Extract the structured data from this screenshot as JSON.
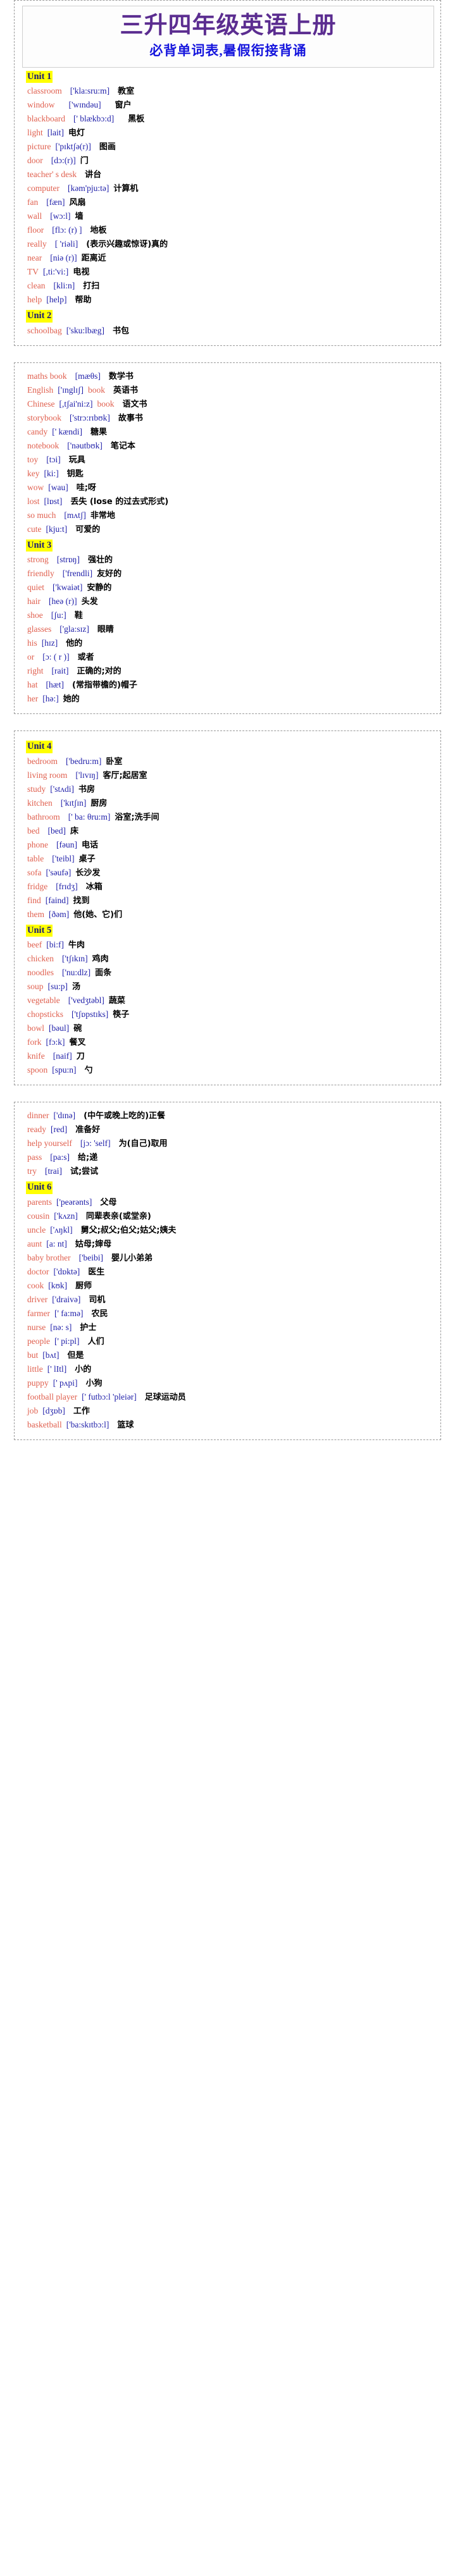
{
  "document": {
    "title_main": "三升四年级英语上册",
    "title_sub": "必背单词表,暑假衔接背诵",
    "colors": {
      "title_main": "#5b2d90",
      "title_sub": "#1515dd",
      "english_word": "#e0604f",
      "phonetic": "#1d1da8",
      "chinese": "#000000",
      "unit_highlight": "#ffff00",
      "unit_text": "#16167a",
      "page_border": "#9a9a9a"
    }
  },
  "blocks": [
    {
      "id": "block-1",
      "sections": [
        {
          "unit": "Unit 1",
          "words": [
            {
              "en": "classroom",
              "ph": "['kla:sru:m]",
              "cn": "教室",
              "gap1": "m",
              "gap2": "m"
            },
            {
              "en": "window",
              "ph": "['wɪndəu]",
              "cn": "窗户",
              "gap1": "l",
              "gap2": "l"
            },
            {
              "en": "blackboard",
              "ph": "[' blækbɔ:d]",
              "cn": "黑板",
              "gap1": "m",
              "gap2": "l"
            },
            {
              "en": "light",
              "ph": "[lait]",
              "cn": "电灯",
              "gap1": "s",
              "gap2": "s"
            },
            {
              "en": "picture",
              "ph": "['pɪktʃə(r)]",
              "cn": "图画",
              "gap1": "s",
              "gap2": "m"
            },
            {
              "en": "door",
              "ph": "[dɔ:(r)]",
              "cn": "门",
              "gap1": "m",
              "gap2": "s"
            },
            {
              "en": "teacher' s desk",
              "ph": "",
              "cn": "讲台",
              "gap1": "s",
              "gap2": "m"
            },
            {
              "en": "computer",
              "ph": "[kəm'pju:tə]",
              "cn": "计算机",
              "gap1": "m",
              "gap2": "s"
            },
            {
              "en": "fan",
              "ph": "[fæn]",
              "cn": "风扇",
              "gap1": "m",
              "gap2": "s"
            },
            {
              "en": "wall",
              "ph": "[wɔ:l]",
              "cn": "墙",
              "gap1": "m",
              "gap2": "s"
            },
            {
              "en": "floor",
              "ph": "[flɔ: (r) ]",
              "cn": "地板",
              "gap1": "m",
              "gap2": "m"
            },
            {
              "en": "really",
              "ph": "[ 'riəli]",
              "cn": "(表示兴趣或惊讶)真的",
              "gap1": "m",
              "gap2": "m"
            },
            {
              "en": "near",
              "ph": "[niə (r)]",
              "cn": "距离近",
              "gap1": "m",
              "gap2": "s"
            },
            {
              "en": "TV",
              "ph": "[,ti:'vi:]",
              "cn": "电视",
              "gap1": "s",
              "gap2": "s"
            },
            {
              "en": "clean",
              "ph": "[kli:n]",
              "cn": "打扫",
              "gap1": "m",
              "gap2": "m"
            },
            {
              "en": "help",
              "ph": "[help]",
              "cn": "帮助",
              "gap1": "s",
              "gap2": "m"
            }
          ]
        },
        {
          "unit": "Unit 2",
          "words": [
            {
              "en": "schoolbag",
              "ph": "['sku:lbæg]",
              "cn": "书包",
              "gap1": "s",
              "gap2": "m"
            }
          ]
        }
      ]
    },
    {
      "id": "block-2",
      "sections": [
        {
          "unit": "",
          "words": [
            {
              "en": "maths book",
              "ph": "[mæθs]",
              "cn": "数学书",
              "gap1": "m",
              "gap2": "m"
            },
            {
              "en": "English",
              "ph": "['ɪnglɪʃ]",
              "cn": "英语书",
              "suffix": "book",
              "gap1": "s",
              "gap2": "m"
            },
            {
              "en": "Chinese",
              "ph": "[,tʃai'ni:z]",
              "cn": "语文书",
              "suffix": "book",
              "gap1": "s",
              "gap2": "m"
            },
            {
              "en": "storybook",
              "ph": "['strɔ:rɪbʊk]",
              "cn": "故事书",
              "gap1": "m",
              "gap2": "m"
            },
            {
              "en": "candy",
              "ph": "[' kændi]",
              "cn": "糖果",
              "gap1": "s",
              "gap2": "m"
            },
            {
              "en": "notebook",
              "ph": "['nəutbʊk]",
              "cn": "笔记本",
              "gap1": "m",
              "gap2": "m"
            },
            {
              "en": "toy",
              "ph": "[tɔi]",
              "cn": "玩具",
              "gap1": "m",
              "gap2": "m"
            },
            {
              "en": "key",
              "ph": "[ki:]",
              "cn": "钥匙",
              "gap1": "s",
              "gap2": "m"
            },
            {
              "en": "wow",
              "ph": "[wau]",
              "cn": "哇;呀",
              "gap1": "s",
              "gap2": "m"
            },
            {
              "en": "lost",
              "ph": "[lɒst]",
              "cn": "丢失 (lose 的过去式形式)",
              "gap1": "s",
              "gap2": "m"
            },
            {
              "en": "so much",
              "ph": "[mʌtʃ]",
              "cn": "非常地",
              "gap1": "m",
              "gap2": "s"
            },
            {
              "en": "cute",
              "ph": "[kju:t]",
              "cn": "可爱的",
              "gap1": "s",
              "gap2": "m"
            }
          ]
        },
        {
          "unit": "Unit 3",
          "words": [
            {
              "en": "strong",
              "ph": "[strɒŋ]",
              "cn": "强壮的",
              "gap1": "m",
              "gap2": "m"
            },
            {
              "en": "friendly",
              "ph": "['frendli]",
              "cn": "友好的",
              "gap1": "m",
              "gap2": "s"
            },
            {
              "en": "quiet",
              "ph": "['kwaiət]",
              "cn": "安静的",
              "gap1": "m",
              "gap2": "s"
            },
            {
              "en": "hair",
              "ph": "[heə (r)]",
              "cn": "头发",
              "gap1": "m",
              "gap2": "s"
            },
            {
              "en": "shoe",
              "ph": "[ʃu:]",
              "cn": "鞋",
              "gap1": "m",
              "gap2": "m"
            },
            {
              "en": "glasses",
              "ph": "['gla:sɪz]",
              "cn": "眼睛",
              "gap1": "m",
              "gap2": "m"
            },
            {
              "en": "his",
              "ph": "[hɪz]",
              "cn": "他的",
              "gap1": "s",
              "gap2": "m"
            },
            {
              "en": "or",
              "ph": "[ɔ: ( r )]",
              "cn": "或者",
              "gap1": "m",
              "gap2": "m"
            },
            {
              "en": "right",
              "ph": "[rait]",
              "cn": "正确的;对的",
              "gap1": "m",
              "gap2": "m"
            },
            {
              "en": "hat",
              "ph": "[hæt]",
              "cn": "(常指带檐的)帽子",
              "gap1": "m",
              "gap2": "m"
            },
            {
              "en": "her",
              "ph": "[hə:]",
              "cn": "她的",
              "gap1": "s",
              "gap2": "s"
            }
          ]
        }
      ]
    },
    {
      "id": "block-3",
      "sections": [
        {
          "unit": "Unit 4",
          "words": [
            {
              "en": "bedroom",
              "ph": "['bedru:m]",
              "cn": "卧室",
              "gap1": "m",
              "gap2": "s"
            },
            {
              "en": "living room",
              "ph": "['lɪvɪŋ]",
              "cn": "客厅;起居室",
              "gap1": "m",
              "gap2": "s"
            },
            {
              "en": "study",
              "ph": "['stʌdi]",
              "cn": "书房",
              "gap1": "s",
              "gap2": "s"
            },
            {
              "en": "kitchen",
              "ph": "['kɪtʃɪn]",
              "cn": "厨房",
              "gap1": "m",
              "gap2": "s"
            },
            {
              "en": "bathroom",
              "ph": "[' ba: θru:m]",
              "cn": "浴室;洗手间",
              "gap1": "m",
              "gap2": "s"
            },
            {
              "en": "bed",
              "ph": "[bed]",
              "cn": "床",
              "gap1": "m",
              "gap2": "s"
            },
            {
              "en": "phone",
              "ph": "[fəun]",
              "cn": "电话",
              "gap1": "m",
              "gap2": "s"
            },
            {
              "en": "table",
              "ph": "['teibl]",
              "cn": "桌子",
              "gap1": "m",
              "gap2": "s"
            },
            {
              "en": "sofa",
              "ph": "['səufə]",
              "cn": "长沙发",
              "gap1": "s",
              "gap2": "s"
            },
            {
              "en": "fridge",
              "ph": "[frɪdʒ]",
              "cn": "冰箱",
              "gap1": "m",
              "gap2": "m"
            },
            {
              "en": "find",
              "ph": "[faind]",
              "cn": "找到",
              "gap1": "s",
              "gap2": "s"
            },
            {
              "en": "them",
              "ph": "[ðəm]",
              "cn": "他(她、它)们",
              "gap1": "s",
              "gap2": "s"
            }
          ]
        },
        {
          "unit": "Unit 5",
          "words": [
            {
              "en": "beef",
              "ph": "[bi:f]",
              "cn": "牛肉",
              "gap1": "s",
              "gap2": "s"
            },
            {
              "en": "chicken",
              "ph": "['tʃɪkɪn]",
              "cn": "鸡肉",
              "gap1": "m",
              "gap2": "s"
            },
            {
              "en": "noodles",
              "ph": "['nu:dlz]",
              "cn": "面条",
              "gap1": "m",
              "gap2": "s"
            },
            {
              "en": "soup",
              "ph": "[su:p]",
              "cn": "汤",
              "gap1": "s",
              "gap2": "s"
            },
            {
              "en": "vegetable",
              "ph": "['vedʒtəbl]",
              "cn": "蔬菜",
              "gap1": "m",
              "gap2": "s"
            },
            {
              "en": "chopsticks",
              "ph": "['tʃɒpstɪks]",
              "cn": "筷子",
              "gap1": "m",
              "gap2": "s"
            },
            {
              "en": "bowl",
              "ph": "[bəul]",
              "cn": "碗",
              "gap1": "s",
              "gap2": "s"
            },
            {
              "en": "fork",
              "ph": "[fɔ:k]",
              "cn": "餐叉",
              "gap1": "s",
              "gap2": "s"
            },
            {
              "en": "knife",
              "ph": "[naif]",
              "cn": "刀",
              "gap1": "m",
              "gap2": "s"
            },
            {
              "en": "spoon",
              "ph": "[spu:n]",
              "cn": "勺",
              "gap1": "s",
              "gap2": "m"
            }
          ]
        }
      ]
    },
    {
      "id": "block-4",
      "sections": [
        {
          "unit": "",
          "words": [
            {
              "en": "dinner",
              "ph": "['dɪnə]",
              "cn": "(中午或晚上吃的)正餐",
              "gap1": "s",
              "gap2": "m"
            },
            {
              "en": "ready",
              "ph": "[red]",
              "cn": "准备好",
              "gap1": "s",
              "gap2": "m"
            },
            {
              "en": "help yourself",
              "ph": "[jɔ: 'self]",
              "cn": "为(自己)取用",
              "gap1": "m",
              "gap2": "m"
            },
            {
              "en": "pass",
              "ph": "[pa:s]",
              "cn": "给;递",
              "gap1": "m",
              "gap2": "m"
            },
            {
              "en": "try",
              "ph": "[trai]",
              "cn": "试;尝试",
              "gap1": "m",
              "gap2": "m"
            }
          ]
        },
        {
          "unit": "Unit 6",
          "words": [
            {
              "en": "parents",
              "ph": "['peərənts]",
              "cn": "父母",
              "gap1": "s",
              "gap2": "m"
            },
            {
              "en": "cousin",
              "ph": "['kʌzn]",
              "cn": "同辈表亲(或堂亲)",
              "gap1": "s",
              "gap2": "m"
            },
            {
              "en": "uncle",
              "ph": "['ʌŋkl]",
              "cn": "舅父;叔父;伯父;姑父;姨夫",
              "gap1": "s",
              "gap2": "m"
            },
            {
              "en": "aunt",
              "ph": "[a: nt]",
              "cn": "姑母;婶母",
              "gap1": "s",
              "gap2": "m"
            },
            {
              "en": "baby brother",
              "ph": "['beibi]",
              "cn": "婴儿小弟弟",
              "gap1": "m",
              "gap2": "m"
            },
            {
              "en": "doctor",
              "ph": "['dɒktə]",
              "cn": "医生",
              "gap1": "s",
              "gap2": "m"
            },
            {
              "en": "cook",
              "ph": "[kʊk]",
              "cn": "厨师",
              "gap1": "s",
              "gap2": "m"
            },
            {
              "en": "driver",
              "ph": "['draivə]",
              "cn": "司机",
              "gap1": "s",
              "gap2": "m"
            },
            {
              "en": "farmer",
              "ph": "[' fa:mə]",
              "cn": "农民",
              "gap1": "s",
              "gap2": "m"
            },
            {
              "en": "nurse",
              "ph": "[nə: s]",
              "cn": "护士",
              "gap1": "s",
              "gap2": "m"
            },
            {
              "en": "people",
              "ph": "[' pi:pl]",
              "cn": "人们",
              "gap1": "s",
              "gap2": "m"
            },
            {
              "en": "but",
              "ph": "[bʌt]",
              "cn": "但是",
              "gap1": "s",
              "gap2": "m"
            },
            {
              "en": "little",
              "ph": "[' lItl]",
              "cn": "小的",
              "gap1": "s",
              "gap2": "m"
            },
            {
              "en": "puppy",
              "ph": "[' pʌpi]",
              "cn": "小狗",
              "gap1": "s",
              "gap2": "m"
            },
            {
              "en": "football player",
              "ph": "[' futbɔ:l 'pleiər]",
              "cn": "足球运动员",
              "gap1": "s",
              "gap2": "m"
            },
            {
              "en": "job",
              "ph": "[dʒɒb]",
              "cn": "工作",
              "gap1": "s",
              "gap2": "m"
            },
            {
              "en": "basketball",
              "ph": "['ba:skɪtbɔ:l]",
              "cn": "篮球",
              "gap1": "s",
              "gap2": "m"
            }
          ]
        }
      ]
    }
  ]
}
